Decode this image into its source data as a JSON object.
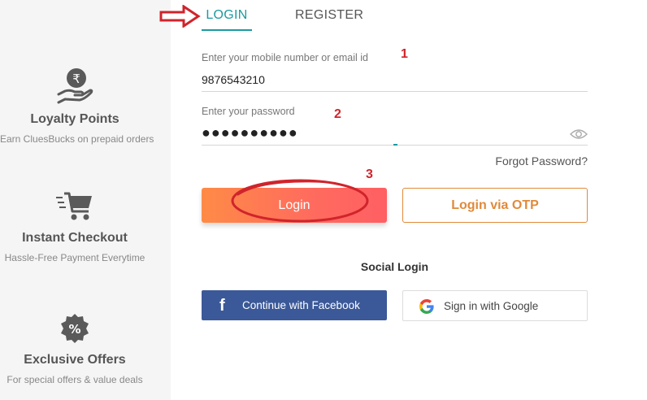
{
  "features": [
    {
      "icon": "rupee-hand-icon",
      "title": "Loyalty Points",
      "subtitle": "Earn CluesBucks on prepaid orders"
    },
    {
      "icon": "cart-icon",
      "title": "Instant Checkout",
      "subtitle": "Hassle-Free Payment Everytime"
    },
    {
      "icon": "percent-badge-icon",
      "title": "Exclusive Offers",
      "subtitle": "For special offers & value deals"
    }
  ],
  "tabs": {
    "login": "LOGIN",
    "register": "REGISTER",
    "active": "login"
  },
  "form": {
    "id_label": "Enter your mobile number or email id",
    "id_value": "9876543210",
    "password_label": "Enter your password",
    "password_masked": "●●●●●●●●●●",
    "forgot": "Forgot Password?",
    "login_button": "Login",
    "otp_button": "Login via OTP"
  },
  "annotations": {
    "step1": "1",
    "step2": "2",
    "step3": "3"
  },
  "social": {
    "title": "Social Login",
    "facebook": "Continue with Facebook",
    "google": "Sign in with Google"
  },
  "colors": {
    "accent": "#1a9aa0",
    "facebook": "#3b5998",
    "otp": "#e08a3a",
    "annotation": "#d0242b"
  }
}
